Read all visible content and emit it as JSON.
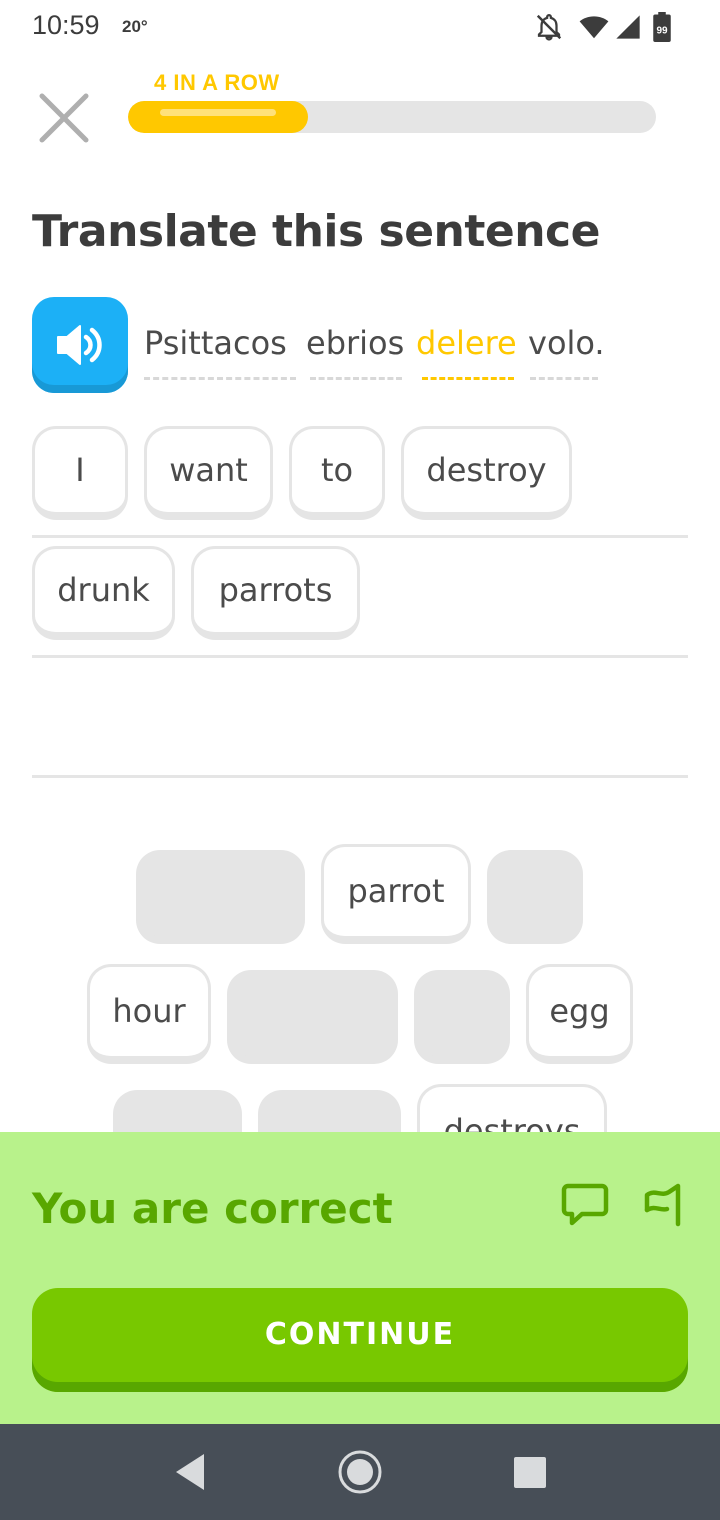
{
  "status_bar": {
    "time": "10:59",
    "temperature": "20°",
    "battery": "99",
    "icons": [
      "notifications-off-icon",
      "wifi-icon",
      "cell-signal-icon",
      "battery-icon"
    ]
  },
  "header": {
    "close_icon": "close-icon",
    "streak_label": "4 IN A ROW",
    "progress_fraction": 0.34
  },
  "challenge": {
    "title": "Translate this sentence",
    "speaker_icon": "speaker-icon",
    "sentence": [
      {
        "text": "Psittacos",
        "highlighted": false
      },
      {
        "text": "ebrios",
        "highlighted": false
      },
      {
        "text": "delere",
        "highlighted": true
      },
      {
        "text": "volo.",
        "highlighted": false
      }
    ]
  },
  "answer": {
    "row1": [
      "I",
      "want",
      "to",
      "destroy"
    ],
    "row2": [
      "drunk",
      "parrots"
    ]
  },
  "word_bank": {
    "row1": [
      "",
      "parrot",
      ""
    ],
    "row2": [
      "hour",
      "",
      "",
      "egg"
    ],
    "row3": [
      "",
      "",
      "destroys"
    ]
  },
  "feedback": {
    "message": "You are correct",
    "comment_icon": "comment-icon",
    "flag_icon": "flag-icon",
    "continue_label": "CONTINUE"
  },
  "colors": {
    "accent_yellow": "#ffc800",
    "speaker_blue": "#1cb0f6",
    "success_bg": "#b8f28b",
    "success_text": "#58a700",
    "button_green": "#78c800"
  },
  "nav_bar": {
    "icons": [
      "back-icon",
      "home-icon",
      "recents-icon"
    ]
  }
}
